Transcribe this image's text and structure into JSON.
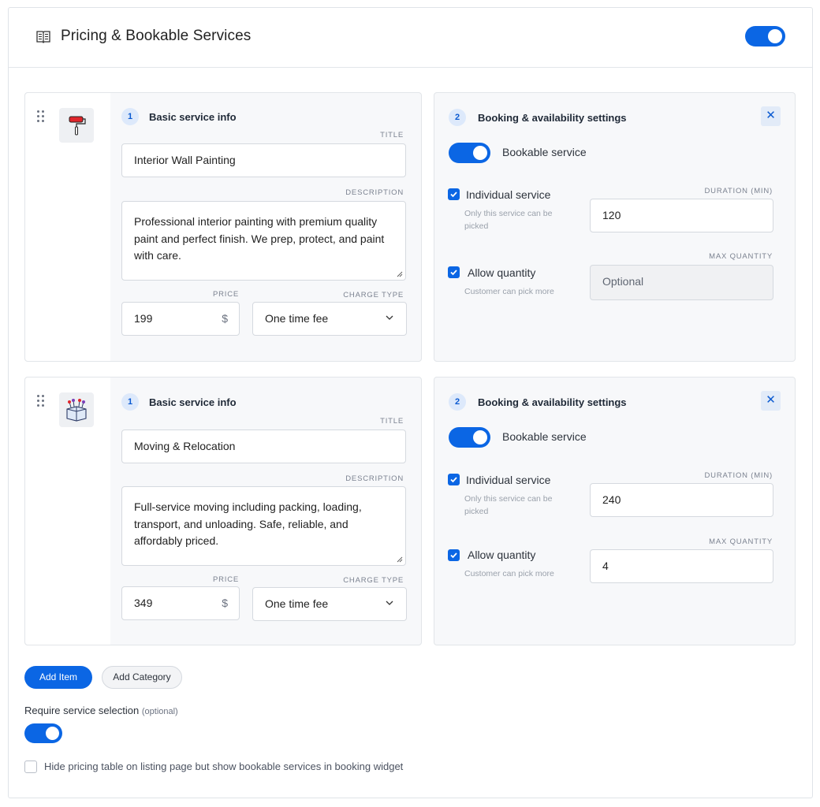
{
  "header": {
    "title": "Pricing & Bookable Services"
  },
  "items": [
    {
      "thumb_icon": "paint-roller-icon",
      "basic": {
        "step": "1",
        "title": "Basic service info",
        "title_label": "TITLE",
        "title_value": "Interior Wall Painting",
        "description_label": "DESCRIPTION",
        "description_value": "Professional interior painting with premium quality paint and perfect finish. We prep, protect, and paint with care.",
        "price_label": "PRICE",
        "price_value": "199",
        "currency": "$",
        "charge_label": "CHARGE TYPE",
        "charge_value": "One time fee"
      },
      "booking": {
        "step": "2",
        "title": "Booking & availability settings",
        "bookable_label": "Bookable service",
        "individual_label": "Individual service",
        "individual_sub": "Only this service can be picked",
        "duration_label": "DURATION (MIN)",
        "duration_value": "120",
        "quantity_label": "Allow quantity",
        "quantity_sub": "Customer can pick more",
        "max_quantity_label": "MAX QUANTITY",
        "max_quantity_value": "Optional"
      }
    },
    {
      "thumb_icon": "moving-box-icon",
      "basic": {
        "step": "1",
        "title": "Basic service info",
        "title_label": "TITLE",
        "title_value": "Moving & Relocation",
        "description_label": "DESCRIPTION",
        "description_value": "Full-service moving including packing, loading, transport, and unloading. Safe, reliable, and affordably priced.",
        "price_label": "PRICE",
        "price_value": "349",
        "currency": "$",
        "charge_label": "CHARGE TYPE",
        "charge_value": "One time fee"
      },
      "booking": {
        "step": "2",
        "title": "Booking & availability settings",
        "bookable_label": "Bookable service",
        "individual_label": "Individual service",
        "individual_sub": "Only this service can be picked",
        "duration_label": "DURATION (MIN)",
        "duration_value": "240",
        "quantity_label": "Allow quantity",
        "quantity_sub": "Customer can pick more",
        "max_quantity_label": "MAX QUANTITY",
        "max_quantity_value": "4"
      }
    }
  ],
  "actions": {
    "add_item": "Add Item",
    "add_category": "Add Category"
  },
  "require": {
    "label": "Require service selection",
    "optional": "(optional)"
  },
  "hide_pricing": {
    "label": "Hide pricing table on listing page but show bookable services in booking widget"
  },
  "colors": {
    "accent": "#0b66e4",
    "card_bg": "#f7f8fa",
    "border": "#e2e5e9"
  }
}
